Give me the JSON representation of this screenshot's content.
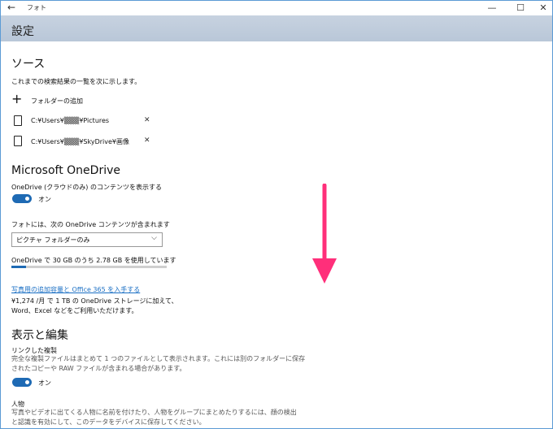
{
  "window": {
    "title": "フォト",
    "minimize": "—",
    "maximize": "☐",
    "close": "✕"
  },
  "header": {
    "title": "設定"
  },
  "sources": {
    "heading": "ソース",
    "description": "これまでの検索結果の一覧を次に示します。",
    "add_folder": "フォルダーの追加",
    "folders": [
      {
        "path": "C:¥Users¥▒▒▒¥Pictures"
      },
      {
        "path": "C:¥Users¥▒▒▒¥SkyDrive¥画像"
      }
    ]
  },
  "onedrive": {
    "heading": "Microsoft OneDrive",
    "show_label": "OneDrive (クラウドのみ) のコンテンツを表示する",
    "show_state": "オン",
    "include_label": "フォトには、次の OneDrive コンテンツが含まれます",
    "include_selected": "ピクチャ フォルダーのみ",
    "usage_text": "OneDrive で 30 GB のうち 2.78 GB を使用しています",
    "usage_fraction": 0.093,
    "upgrade_link": "写真用の追加容量と Office 365 を入手する",
    "upgrade_desc_1": "¥1,274 /月 で 1 TB の OneDrive ストレージに加えて、",
    "upgrade_desc_2": "Word、Excel などをご利用いただけます。"
  },
  "display": {
    "heading": "表示と編集",
    "duplicates_title": "リンクした複製",
    "duplicates_desc_1": "完全な複製ファイルはまとめて 1 つのファイルとして表示されます。これには別のフォルダーに保存",
    "duplicates_desc_2": "されたコピーや RAW ファイルが含まれる場合があります。",
    "duplicates_state": "オン",
    "people_title": "人物",
    "people_desc_1": "写真やビデオに出てくる人物に名前を付けたり、人物をグループにまとめたりするには、顔の検出",
    "people_desc_2": "と認識を有効にして、このデータをデバイスに保存してください。"
  },
  "colors": {
    "accent": "#1e6ab4",
    "arrow": "#ff2f7a",
    "header": "#bfcbdc"
  },
  "icons": {
    "back": "arrow-left-icon",
    "add": "plus-icon",
    "folder": "tablet-icon",
    "remove": "close-icon"
  }
}
